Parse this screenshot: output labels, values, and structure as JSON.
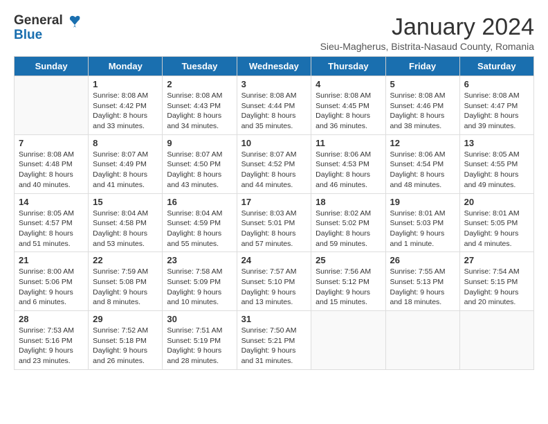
{
  "header": {
    "logo_general": "General",
    "logo_blue": "Blue",
    "title": "January 2024",
    "location": "Sieu-Magherus, Bistrita-Nasaud County, Romania"
  },
  "weekdays": [
    "Sunday",
    "Monday",
    "Tuesday",
    "Wednesday",
    "Thursday",
    "Friday",
    "Saturday"
  ],
  "weeks": [
    [
      {
        "day": "",
        "sunrise": "",
        "sunset": "",
        "daylight": ""
      },
      {
        "day": "1",
        "sunrise": "Sunrise: 8:08 AM",
        "sunset": "Sunset: 4:42 PM",
        "daylight": "Daylight: 8 hours and 33 minutes."
      },
      {
        "day": "2",
        "sunrise": "Sunrise: 8:08 AM",
        "sunset": "Sunset: 4:43 PM",
        "daylight": "Daylight: 8 hours and 34 minutes."
      },
      {
        "day": "3",
        "sunrise": "Sunrise: 8:08 AM",
        "sunset": "Sunset: 4:44 PM",
        "daylight": "Daylight: 8 hours and 35 minutes."
      },
      {
        "day": "4",
        "sunrise": "Sunrise: 8:08 AM",
        "sunset": "Sunset: 4:45 PM",
        "daylight": "Daylight: 8 hours and 36 minutes."
      },
      {
        "day": "5",
        "sunrise": "Sunrise: 8:08 AM",
        "sunset": "Sunset: 4:46 PM",
        "daylight": "Daylight: 8 hours and 38 minutes."
      },
      {
        "day": "6",
        "sunrise": "Sunrise: 8:08 AM",
        "sunset": "Sunset: 4:47 PM",
        "daylight": "Daylight: 8 hours and 39 minutes."
      }
    ],
    [
      {
        "day": "7",
        "sunrise": "Sunrise: 8:08 AM",
        "sunset": "Sunset: 4:48 PM",
        "daylight": "Daylight: 8 hours and 40 minutes."
      },
      {
        "day": "8",
        "sunrise": "Sunrise: 8:07 AM",
        "sunset": "Sunset: 4:49 PM",
        "daylight": "Daylight: 8 hours and 41 minutes."
      },
      {
        "day": "9",
        "sunrise": "Sunrise: 8:07 AM",
        "sunset": "Sunset: 4:50 PM",
        "daylight": "Daylight: 8 hours and 43 minutes."
      },
      {
        "day": "10",
        "sunrise": "Sunrise: 8:07 AM",
        "sunset": "Sunset: 4:52 PM",
        "daylight": "Daylight: 8 hours and 44 minutes."
      },
      {
        "day": "11",
        "sunrise": "Sunrise: 8:06 AM",
        "sunset": "Sunset: 4:53 PM",
        "daylight": "Daylight: 8 hours and 46 minutes."
      },
      {
        "day": "12",
        "sunrise": "Sunrise: 8:06 AM",
        "sunset": "Sunset: 4:54 PM",
        "daylight": "Daylight: 8 hours and 48 minutes."
      },
      {
        "day": "13",
        "sunrise": "Sunrise: 8:05 AM",
        "sunset": "Sunset: 4:55 PM",
        "daylight": "Daylight: 8 hours and 49 minutes."
      }
    ],
    [
      {
        "day": "14",
        "sunrise": "Sunrise: 8:05 AM",
        "sunset": "Sunset: 4:57 PM",
        "daylight": "Daylight: 8 hours and 51 minutes."
      },
      {
        "day": "15",
        "sunrise": "Sunrise: 8:04 AM",
        "sunset": "Sunset: 4:58 PM",
        "daylight": "Daylight: 8 hours and 53 minutes."
      },
      {
        "day": "16",
        "sunrise": "Sunrise: 8:04 AM",
        "sunset": "Sunset: 4:59 PM",
        "daylight": "Daylight: 8 hours and 55 minutes."
      },
      {
        "day": "17",
        "sunrise": "Sunrise: 8:03 AM",
        "sunset": "Sunset: 5:01 PM",
        "daylight": "Daylight: 8 hours and 57 minutes."
      },
      {
        "day": "18",
        "sunrise": "Sunrise: 8:02 AM",
        "sunset": "Sunset: 5:02 PM",
        "daylight": "Daylight: 8 hours and 59 minutes."
      },
      {
        "day": "19",
        "sunrise": "Sunrise: 8:01 AM",
        "sunset": "Sunset: 5:03 PM",
        "daylight": "Daylight: 9 hours and 1 minute."
      },
      {
        "day": "20",
        "sunrise": "Sunrise: 8:01 AM",
        "sunset": "Sunset: 5:05 PM",
        "daylight": "Daylight: 9 hours and 4 minutes."
      }
    ],
    [
      {
        "day": "21",
        "sunrise": "Sunrise: 8:00 AM",
        "sunset": "Sunset: 5:06 PM",
        "daylight": "Daylight: 9 hours and 6 minutes."
      },
      {
        "day": "22",
        "sunrise": "Sunrise: 7:59 AM",
        "sunset": "Sunset: 5:08 PM",
        "daylight": "Daylight: 9 hours and 8 minutes."
      },
      {
        "day": "23",
        "sunrise": "Sunrise: 7:58 AM",
        "sunset": "Sunset: 5:09 PM",
        "daylight": "Daylight: 9 hours and 10 minutes."
      },
      {
        "day": "24",
        "sunrise": "Sunrise: 7:57 AM",
        "sunset": "Sunset: 5:10 PM",
        "daylight": "Daylight: 9 hours and 13 minutes."
      },
      {
        "day": "25",
        "sunrise": "Sunrise: 7:56 AM",
        "sunset": "Sunset: 5:12 PM",
        "daylight": "Daylight: 9 hours and 15 minutes."
      },
      {
        "day": "26",
        "sunrise": "Sunrise: 7:55 AM",
        "sunset": "Sunset: 5:13 PM",
        "daylight": "Daylight: 9 hours and 18 minutes."
      },
      {
        "day": "27",
        "sunrise": "Sunrise: 7:54 AM",
        "sunset": "Sunset: 5:15 PM",
        "daylight": "Daylight: 9 hours and 20 minutes."
      }
    ],
    [
      {
        "day": "28",
        "sunrise": "Sunrise: 7:53 AM",
        "sunset": "Sunset: 5:16 PM",
        "daylight": "Daylight: 9 hours and 23 minutes."
      },
      {
        "day": "29",
        "sunrise": "Sunrise: 7:52 AM",
        "sunset": "Sunset: 5:18 PM",
        "daylight": "Daylight: 9 hours and 26 minutes."
      },
      {
        "day": "30",
        "sunrise": "Sunrise: 7:51 AM",
        "sunset": "Sunset: 5:19 PM",
        "daylight": "Daylight: 9 hours and 28 minutes."
      },
      {
        "day": "31",
        "sunrise": "Sunrise: 7:50 AM",
        "sunset": "Sunset: 5:21 PM",
        "daylight": "Daylight: 9 hours and 31 minutes."
      },
      {
        "day": "",
        "sunrise": "",
        "sunset": "",
        "daylight": ""
      },
      {
        "day": "",
        "sunrise": "",
        "sunset": "",
        "daylight": ""
      },
      {
        "day": "",
        "sunrise": "",
        "sunset": "",
        "daylight": ""
      }
    ]
  ]
}
